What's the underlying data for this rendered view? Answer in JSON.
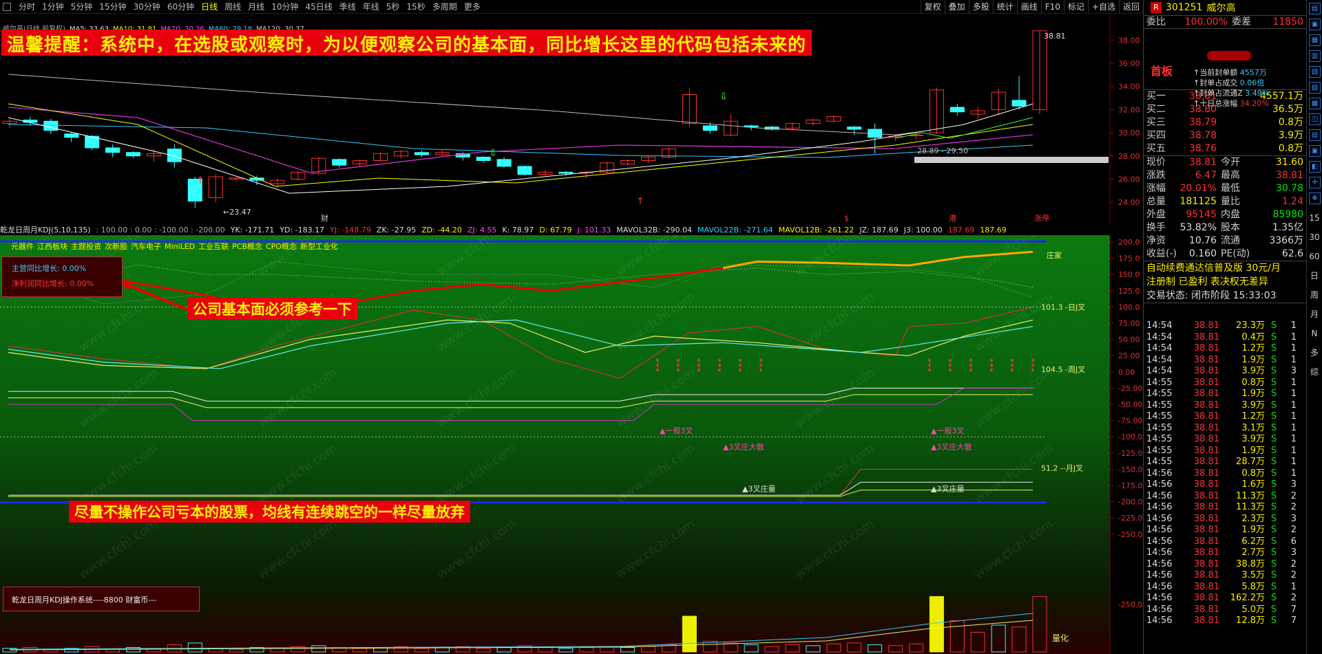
{
  "toolbar": {
    "periods": [
      "分时",
      "1分钟",
      "5分钟",
      "15分钟",
      "30分钟",
      "60分钟",
      "日线",
      "周线",
      "月线",
      "10分钟",
      "45日线",
      "季线",
      "年线",
      "5秒",
      "15秒",
      "多周期",
      "更多"
    ],
    "active_period": "日线",
    "right_buttons": [
      "复权",
      "叠加",
      "多股",
      "统计",
      "画线",
      "F10",
      "标记",
      "+自选",
      "返回"
    ]
  },
  "main_chart": {
    "title_items": [
      "威尔高(日线,前复权)",
      "MA5: 33.63",
      "MA10: 31.81",
      "MA20: 30.36",
      "MA60: 29.18",
      "MA120: 30.37"
    ],
    "banner": "温馨提醒：系统中，在选股或观察时，为以便观察公司的基本面，同比增长这里的代码包括未来的",
    "high_label": "38.81",
    "low_label": "23.47",
    "range_label": "28.89 - 29.50",
    "marker_labels": [
      "财",
      "$",
      "港",
      "涨停"
    ],
    "y_ticks": [
      "38.00",
      "36.00",
      "34.00",
      "32.00",
      "30.00",
      "28.00",
      "26.00",
      "24.00"
    ]
  },
  "kdj_bar": {
    "items": [
      {
        "text": "乾龙日周月KDJ(5,10,135)",
        "color": "#ddd"
      },
      {
        "text": ": 100.00 : 0.00 : -100.00 : -200.00",
        "color": "#aaa"
      },
      {
        "text": "YK: -171.71",
        "color": "#ddd"
      },
      {
        "text": "YD: -183.17",
        "color": "#ddd"
      },
      {
        "text": "YJ: -148.79",
        "color": "#ff3232"
      },
      {
        "text": "ZK: -27.95",
        "color": "#ddd"
      },
      {
        "text": "ZD: -44.20",
        "color": "#ffee00"
      },
      {
        "text": "ZJ: 4.55",
        "color": "#ff44ff"
      },
      {
        "text": "K: 78.97",
        "color": "#ddd"
      },
      {
        "text": "D: 67.79",
        "color": "#ffee00"
      },
      {
        "text": "J: 101.33",
        "color": "#ff44ff"
      },
      {
        "text": "MAVOL32B: -290.04",
        "color": "#ddd"
      },
      {
        "text": "MAVOL22B: -271.64",
        "color": "#3cf"
      },
      {
        "text": "MAVOL12B: -261.22",
        "color": "#ffee00"
      },
      {
        "text": "JZ: 187.69",
        "color": "#ddd"
      },
      {
        "text": "J3: 100.00",
        "color": "#ddd"
      },
      {
        "text": "187.69",
        "color": "#ff3232"
      },
      {
        "text": "187.69",
        "color": "#ffee00"
      }
    ]
  },
  "concepts": [
    "元器件",
    "江西板块",
    "主题投资",
    "次新股",
    "汽车电子",
    "MiniLED",
    "工业互联",
    "PCB概念",
    "CPO概念",
    "新型工业化"
  ],
  "fundamentals": {
    "revenue_label": "主营同比增长: ",
    "revenue_value": "0.00%",
    "profit_label": "净利润同比增长: ",
    "profit_value": "0.00%"
  },
  "notes": {
    "mid": "公司基本面必须参考一下",
    "bottom": "尽量不操作公司亏本的股票，均线有连续跳空的一样尽量放弃"
  },
  "kdj_chart": {
    "y_ticks": [
      "200.0",
      "175.0",
      "150.0",
      "125.0",
      "100.0",
      "75.00",
      "50.00",
      "25.00",
      "0.00",
      "-25.00",
      "-50.00",
      "-75.00",
      "-100.0",
      "-125.0",
      "-150.0",
      "-175.0",
      "-200.0",
      "-225.0",
      "-250.0"
    ],
    "labels": {
      "zhuangjia": "庄家",
      "day_j": "101.3 -日J叉",
      "week_j": "104.5 -周J叉",
      "month_j": "51.2 --月J叉",
      "yiban1": "▲一般3叉",
      "yiban2": "▲一般3叉",
      "sancha1": "▲3叉庄大散",
      "sancha2": "▲3叉庄大散",
      "zhuangliang1": "▲3叉庄量",
      "zhuangliang2": "▲3叉庄量"
    },
    "watermark": "www.cfchi.com"
  },
  "volume": {
    "system_label": "乾龙日周月KDJ操作系统----8800 财富币---",
    "label": "量化"
  },
  "quote": {
    "code": "301251",
    "name": "威尔高",
    "wei_bi_label": "委比",
    "wei_bi": "100.00%",
    "wei_cha_label": "委差",
    "wei_cha": "11850",
    "limit_title": "首板",
    "limit_lines": [
      {
        "label": "当前封单额",
        "value": "4557万"
      },
      {
        "label": "封单占成交",
        "value": "0.06倍"
      },
      {
        "label": "封单占流通Z",
        "value": "3.49%"
      },
      {
        "label": "十日总涨幅",
        "value": "34.20%"
      }
    ],
    "bids": [
      {
        "label": "买一",
        "price": "38.81",
        "vol": "4557.1万"
      },
      {
        "label": "买二",
        "price": "38.80",
        "vol": "36.5万"
      },
      {
        "label": "买三",
        "price": "38.79",
        "vol": "0.8万"
      },
      {
        "label": "买四",
        "price": "38.78",
        "vol": "3.9万"
      },
      {
        "label": "买五",
        "price": "38.76",
        "vol": "0.8万"
      }
    ],
    "stats": [
      {
        "l1": "现价",
        "v1": "38.81",
        "c1": "red",
        "l2": "今开",
        "v2": "31.60",
        "c2": "yellow"
      },
      {
        "l1": "涨跌",
        "v1": "6.47",
        "c1": "red",
        "l2": "最高",
        "v2": "38.81",
        "c2": "red"
      },
      {
        "l1": "涨幅",
        "v1": "20.01%",
        "c1": "red",
        "l2": "最低",
        "v2": "30.78",
        "c2": "green"
      },
      {
        "l1": "总量",
        "v1": "181125",
        "c1": "yellow",
        "l2": "量比",
        "v2": "1.24",
        "c2": "red"
      },
      {
        "l1": "外盘",
        "v1": "95145",
        "c1": "red",
        "l2": "内盘",
        "v2": "85980",
        "c2": "green"
      },
      {
        "l1": "换手",
        "v1": "53.82%",
        "c1": "white",
        "l2": "股本",
        "v2": "1.35亿",
        "c2": "white"
      },
      {
        "l1": "净资",
        "v1": "10.76",
        "c1": "white",
        "l2": "流通",
        "v2": "3366万",
        "c2": "white"
      },
      {
        "l1": "收益(-)",
        "v1": "0.160",
        "c1": "white",
        "l2": "PE(动)",
        "v2": "62.6",
        "c2": "white"
      }
    ],
    "info_lines": [
      "自动续费通达信普及版 30元/月",
      "注册制 已盈利 表决权无差异",
      "交易状态: 闭市阶段 15:33:03"
    ],
    "ticks": [
      {
        "t": "14:54",
        "p": "38.81",
        "v": "23.3万",
        "bs": "S",
        "n": "1"
      },
      {
        "t": "14:54",
        "p": "38.81",
        "v": "0.4万",
        "bs": "S",
        "n": "1"
      },
      {
        "t": "14:54",
        "p": "38.81",
        "v": "1.2万",
        "bs": "S",
        "n": "1"
      },
      {
        "t": "14:54",
        "p": "38.81",
        "v": "1.9万",
        "bs": "S",
        "n": "1"
      },
      {
        "t": "14:54",
        "p": "38.81",
        "v": "3.9万",
        "bs": "S",
        "n": "3"
      },
      {
        "t": "14:55",
        "p": "38.81",
        "v": "0.8万",
        "bs": "S",
        "n": "1"
      },
      {
        "t": "14:55",
        "p": "38.81",
        "v": "1.9万",
        "bs": "S",
        "n": "1"
      },
      {
        "t": "14:55",
        "p": "38.81",
        "v": "3.9万",
        "bs": "S",
        "n": "1"
      },
      {
        "t": "14:55",
        "p": "38.81",
        "v": "1.2万",
        "bs": "S",
        "n": "1"
      },
      {
        "t": "14:55",
        "p": "38.81",
        "v": "3.1万",
        "bs": "S",
        "n": "1"
      },
      {
        "t": "14:55",
        "p": "38.81",
        "v": "3.9万",
        "bs": "S",
        "n": "1"
      },
      {
        "t": "14:55",
        "p": "38.81",
        "v": "1.9万",
        "bs": "S",
        "n": "1"
      },
      {
        "t": "14:55",
        "p": "38.81",
        "v": "28.7万",
        "bs": "S",
        "n": "1"
      },
      {
        "t": "14:56",
        "p": "38.81",
        "v": "0.8万",
        "bs": "S",
        "n": "1"
      },
      {
        "t": "14:56",
        "p": "38.81",
        "v": "1.6万",
        "bs": "S",
        "n": "3"
      },
      {
        "t": "14:56",
        "p": "38.81",
        "v": "11.3万",
        "bs": "S",
        "n": "2"
      },
      {
        "t": "14:56",
        "p": "38.81",
        "v": "11.3万",
        "bs": "S",
        "n": "2"
      },
      {
        "t": "14:56",
        "p": "38.81",
        "v": "2.3万",
        "bs": "S",
        "n": "3"
      },
      {
        "t": "14:56",
        "p": "38.81",
        "v": "1.9万",
        "bs": "S",
        "n": "2"
      },
      {
        "t": "14:56",
        "p": "38.81",
        "v": "6.2万",
        "bs": "S",
        "n": "6"
      },
      {
        "t": "14:56",
        "p": "38.81",
        "v": "2.7万",
        "bs": "S",
        "n": "3"
      },
      {
        "t": "14:56",
        "p": "38.81",
        "v": "38.8万",
        "bs": "S",
        "n": "2"
      },
      {
        "t": "14:56",
        "p": "38.81",
        "v": "3.5万",
        "bs": "S",
        "n": "2"
      },
      {
        "t": "14:56",
        "p": "38.81",
        "v": "5.8万",
        "bs": "S",
        "n": "1"
      },
      {
        "t": "14:56",
        "p": "38.81",
        "v": "162.2万",
        "bs": "S",
        "n": "2"
      },
      {
        "t": "14:56",
        "p": "38.81",
        "v": "5.0万",
        "bs": "S",
        "n": "7"
      },
      {
        "t": "14:56",
        "p": "38.81",
        "v": "12.8万",
        "bs": "S",
        "n": "7"
      }
    ]
  },
  "side_strip": {
    "texts": [
      "15",
      "30",
      "60",
      "日",
      "周",
      "月",
      "N",
      "多",
      "综"
    ]
  }
}
